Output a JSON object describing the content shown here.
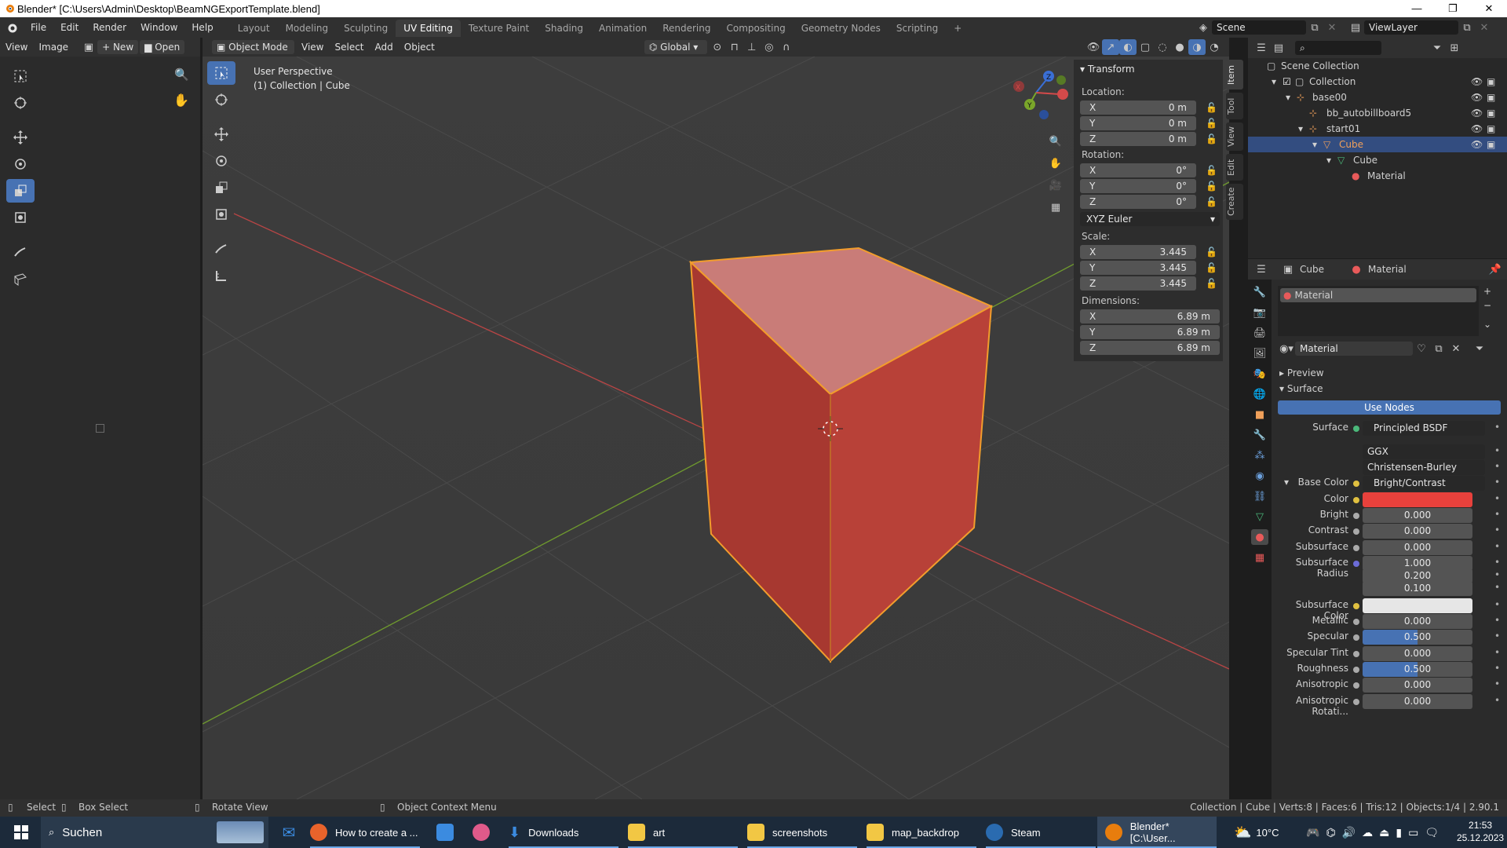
{
  "window": {
    "title": "Blender* [C:\\Users\\Admin\\Desktop\\BeamNGExportTemplate.blend]"
  },
  "menu": [
    "File",
    "Edit",
    "Render",
    "Window",
    "Help"
  ],
  "workspaces": [
    "Layout",
    "Modeling",
    "Sculpting",
    "UV Editing",
    "Texture Paint",
    "Shading",
    "Animation",
    "Rendering",
    "Compositing",
    "Geometry Nodes",
    "Scripting"
  ],
  "active_workspace": "UV Editing",
  "scene": "Scene",
  "view_layer": "ViewLayer",
  "image_editor": {
    "view": "View",
    "image": "Image",
    "new": "New",
    "open": "Open"
  },
  "viewport": {
    "mode": "Object Mode",
    "menus": [
      "View",
      "Select",
      "Add",
      "Object"
    ],
    "transform_orientation": "Global",
    "overlay_title": "User Perspective",
    "overlay_subtitle": "(1) Collection | Cube"
  },
  "npanel": {
    "header": "Transform",
    "location_label": "Location:",
    "rotation_label": "Rotation:",
    "scale_label": "Scale:",
    "dimensions_label": "Dimensions:",
    "location": [
      {
        "axis": "X",
        "value": "0 m"
      },
      {
        "axis": "Y",
        "value": "0 m"
      },
      {
        "axis": "Z",
        "value": "0 m"
      }
    ],
    "rotation": [
      {
        "axis": "X",
        "value": "0°"
      },
      {
        "axis": "Y",
        "value": "0°"
      },
      {
        "axis": "Z",
        "value": "0°"
      }
    ],
    "rotation_mode": "XYZ Euler",
    "scale": [
      {
        "axis": "X",
        "value": "3.445"
      },
      {
        "axis": "Y",
        "value": "3.445"
      },
      {
        "axis": "Z",
        "value": "3.445"
      }
    ],
    "dimensions": [
      {
        "axis": "X",
        "value": "6.89 m"
      },
      {
        "axis": "Y",
        "value": "6.89 m"
      },
      {
        "axis": "Z",
        "value": "6.89 m"
      }
    ],
    "tabs": [
      "Item",
      "Tool",
      "View",
      "Edit",
      "Create"
    ]
  },
  "outliner": {
    "rows": [
      {
        "label": "Scene Collection"
      },
      {
        "label": "Collection"
      },
      {
        "label": "base00"
      },
      {
        "label": "bb_autobillboard5"
      },
      {
        "label": "start01"
      },
      {
        "label": "Cube"
      },
      {
        "label": "Cube"
      },
      {
        "label": "Material"
      }
    ]
  },
  "properties": {
    "breadcrumb_object": "Cube",
    "breadcrumb_material": "Material",
    "slot": "Material",
    "material_name": "Material",
    "preview": "Preview",
    "surface_section": "Surface",
    "use_nodes": "Use Nodes",
    "rows": [
      {
        "label": "Surface",
        "value": "Principled BSDF"
      },
      {
        "label": "",
        "value": "GGX"
      },
      {
        "label": "",
        "value": "Christensen-Burley"
      },
      {
        "label": "Base Color",
        "value": "Bright/Contrast"
      },
      {
        "label": "Color",
        "value": ""
      },
      {
        "label": "Bright",
        "value": "0.000"
      },
      {
        "label": "Contrast",
        "value": "0.000"
      },
      {
        "label": "Subsurface",
        "value": "0.000"
      },
      {
        "label": "Subsurface Radius",
        "value": "1.000"
      },
      {
        "label": "",
        "value": "0.200"
      },
      {
        "label": "",
        "value": "0.100"
      },
      {
        "label": "Subsurface Color",
        "value": ""
      },
      {
        "label": "Metallic",
        "value": "0.000"
      },
      {
        "label": "Specular",
        "value": "0.500"
      },
      {
        "label": "Specular Tint",
        "value": "0.000"
      },
      {
        "label": "Roughness",
        "value": "0.500"
      },
      {
        "label": "Anisotropic",
        "value": "0.000"
      },
      {
        "label": "Anisotropic Rotati...",
        "value": "0.000"
      }
    ],
    "specular_level": 0.5,
    "roughness_level": 0.5,
    "color_value": "#e8413c"
  },
  "statusbar": {
    "select": "Select",
    "box_select": "Box Select",
    "rotate_view": "Rotate View",
    "context_menu": "Object Context Menu",
    "stats": "Collection | Cube | Verts:8 | Faces:6 | Tris:12 | Objects:1/4 | 2.90.1"
  },
  "taskbar": {
    "search": "Suchen",
    "apps": [
      "How to create a ...",
      "Downloads",
      "art",
      "screenshots",
      "map_backdrop",
      "Steam",
      "Blender* [C:\\User..."
    ],
    "temperature": "10°C",
    "time": "21:53",
    "date": "25.12.2023"
  },
  "colors": {
    "accent": "#4772b3",
    "selection_outline": "#f29d2c",
    "cube_front": "#a73830",
    "cube_top": "#c97c78",
    "cube_side": "#b84138"
  }
}
